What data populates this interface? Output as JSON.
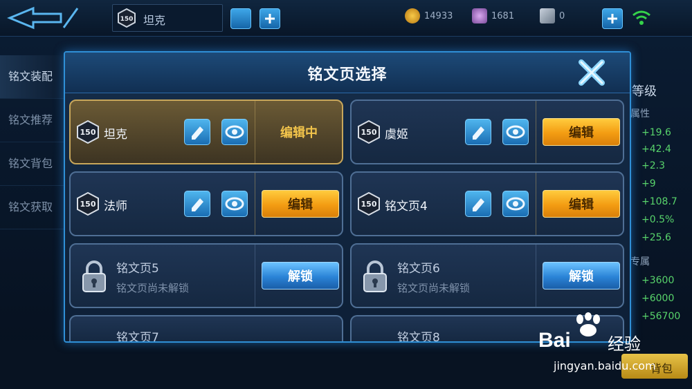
{
  "topbar": {
    "level": "150",
    "page_name": "坦克",
    "coin_amount": "14933",
    "diamond_amount": "1681",
    "ticket_amount": "0"
  },
  "left_nav": {
    "items": [
      {
        "label": "铭文装配"
      },
      {
        "label": "铭文推荐"
      },
      {
        "label": "铭文背包"
      },
      {
        "label": "铭文获取"
      }
    ]
  },
  "right_panel": {
    "title": "等级",
    "attr_label": "属性",
    "attr_values": [
      "+19.6",
      "+42.4",
      "+2.3",
      "+9",
      "+108.7",
      "+0.5%",
      "+25.6"
    ],
    "special_label": "专属",
    "special_values": [
      "+3600",
      "+6000",
      "+56700"
    ]
  },
  "modal": {
    "title": "铭文页选择",
    "cards": [
      {
        "level": "150",
        "name": "坦克",
        "status": "编辑中",
        "current": true
      },
      {
        "level": "150",
        "name": "虞姬",
        "button": "编辑"
      },
      {
        "level": "150",
        "name": "法师",
        "button": "编辑"
      },
      {
        "level": "150",
        "name": "铭文页4",
        "button": "编辑"
      },
      {
        "name": "铭文页5",
        "desc": "铭文页尚未解锁",
        "button": "解锁"
      },
      {
        "name": "铭文页6",
        "desc": "铭文页尚未解锁",
        "button": "解锁"
      },
      {
        "name": "铭文页7"
      },
      {
        "name": "铭文页8"
      }
    ]
  },
  "watermark": {
    "brand": "Bai",
    "brand_suffix": "经验",
    "url": "jingyan.baidu.com",
    "button_text": "背包"
  },
  "colors": {
    "accent_blue": "#2f8fd6",
    "edit_orange": "#f39c12",
    "current_gold": "#c8a75b",
    "positive_green": "#58d46b"
  }
}
